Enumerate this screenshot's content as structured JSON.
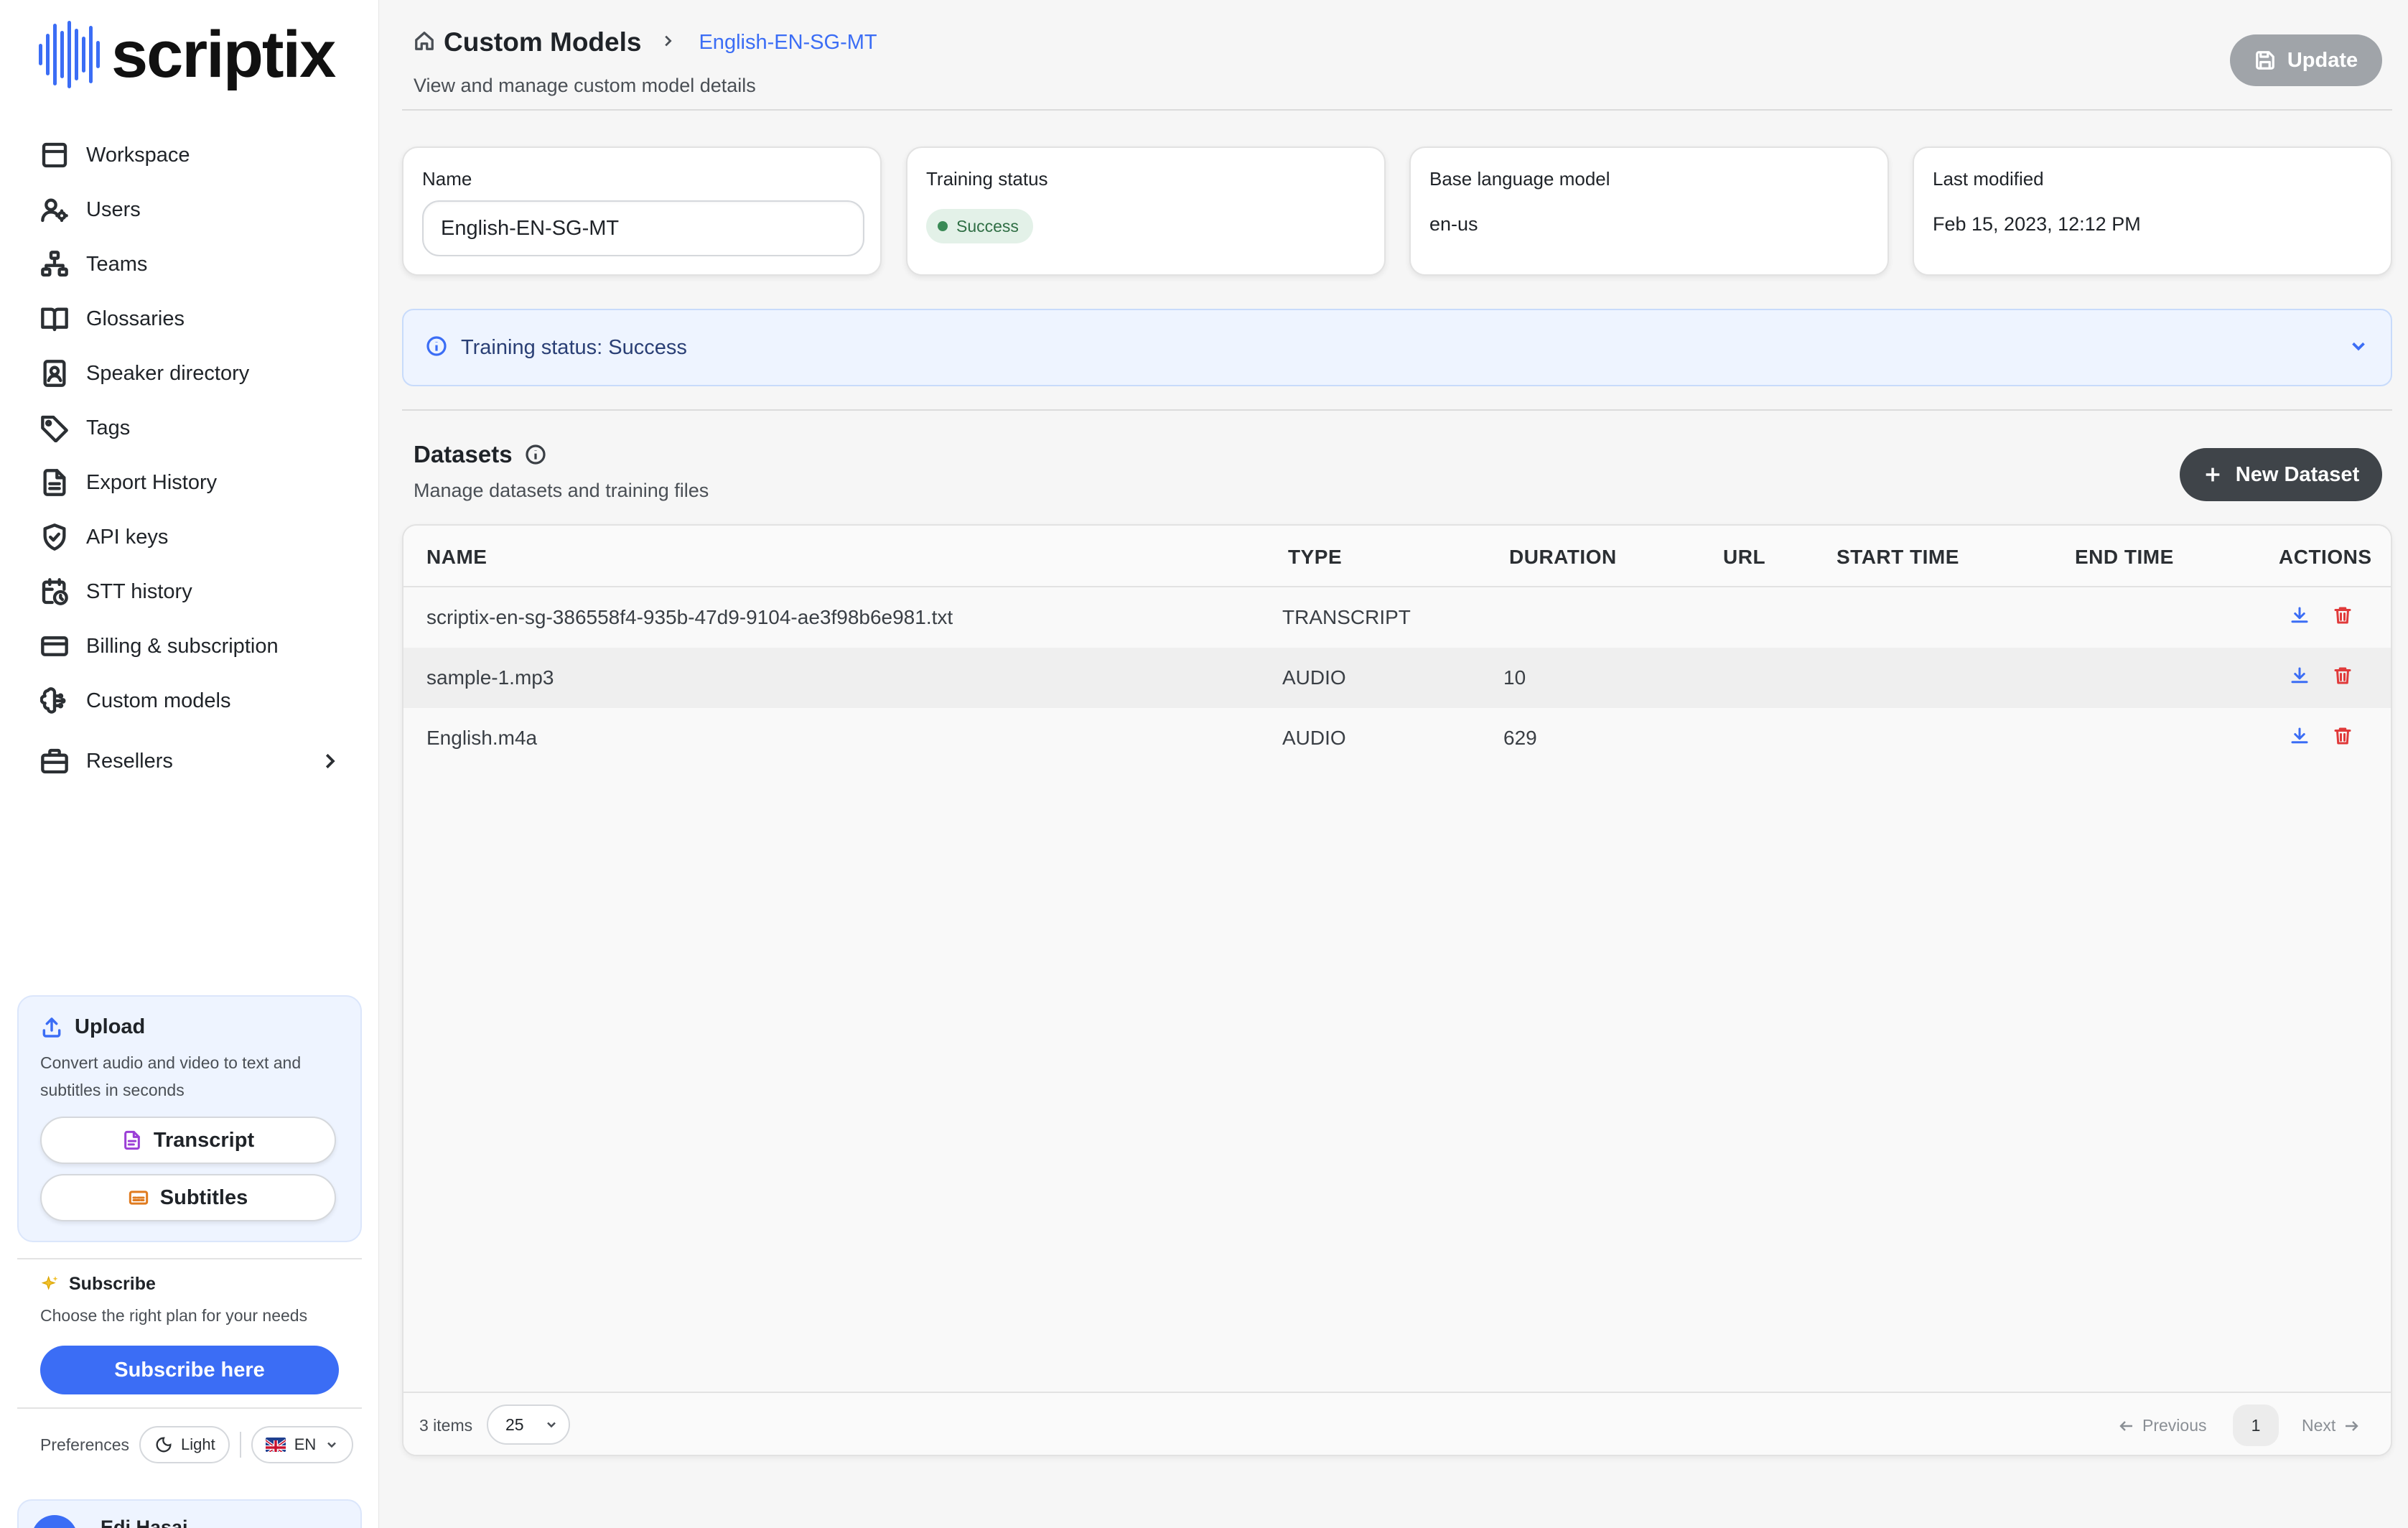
{
  "app": {
    "logo_text": "scriptix"
  },
  "sidebar": {
    "items": [
      {
        "label": "Workspace",
        "icon": "layout-icon"
      },
      {
        "label": "Users",
        "icon": "users-gear-icon"
      },
      {
        "label": "Teams",
        "icon": "org-chart-icon"
      },
      {
        "label": "Glossaries",
        "icon": "book-icon"
      },
      {
        "label": "Speaker directory",
        "icon": "contact-book-icon"
      },
      {
        "label": "Tags",
        "icon": "tag-icon"
      },
      {
        "label": "Export History",
        "icon": "document-icon"
      },
      {
        "label": "API keys",
        "icon": "shield-check-icon"
      },
      {
        "label": "STT history",
        "icon": "calendar-clock-icon"
      },
      {
        "label": "Billing & subscription",
        "icon": "credit-card-icon"
      },
      {
        "label": "Custom models",
        "icon": "brain-icon"
      },
      {
        "label": "Resellers",
        "icon": "briefcase-icon"
      }
    ],
    "upload": {
      "title": "Upload",
      "description": "Convert audio and video to text and subtitles in seconds",
      "transcript_label": "Transcript",
      "subtitles_label": "Subtitles"
    },
    "subscribe": {
      "title": "Subscribe",
      "description": "Choose the right plan for your needs",
      "button_label": "Subscribe here"
    },
    "preferences": {
      "label": "Preferences",
      "theme": "Light",
      "language": "EN"
    },
    "user": {
      "name": "Edi Hasai"
    }
  },
  "header": {
    "title": "Custom Models",
    "breadcrumb_current": "English-EN-SG-MT",
    "subtitle": "View and manage custom model details",
    "update_label": "Update"
  },
  "cards": {
    "name": {
      "label": "Name",
      "value": "English-EN-SG-MT"
    },
    "training_status": {
      "label": "Training status",
      "value": "Success"
    },
    "base_language_model": {
      "label": "Base language model",
      "value": "en-us"
    },
    "last_modified": {
      "label": "Last modified",
      "value": "Feb 15, 2023, 12:12 PM"
    }
  },
  "status_banner": {
    "text": "Training status: Success"
  },
  "datasets": {
    "title": "Datasets",
    "subtitle": "Manage datasets and training files",
    "new_button_label": "New Dataset",
    "columns": [
      "NAME",
      "TYPE",
      "DURATION",
      "URL",
      "START TIME",
      "END TIME",
      "ACTIONS"
    ],
    "rows": [
      {
        "name": "scriptix-en-sg-386558f4-935b-47d9-9104-ae3f98b6e981.txt",
        "type": "TRANSCRIPT",
        "duration": "",
        "url": "",
        "start_time": "",
        "end_time": ""
      },
      {
        "name": "sample-1.mp3",
        "type": "AUDIO",
        "duration": "10",
        "url": "",
        "start_time": "",
        "end_time": ""
      },
      {
        "name": "English.m4a",
        "type": "AUDIO",
        "duration": "629",
        "url": "",
        "start_time": "",
        "end_time": ""
      }
    ],
    "footer": {
      "items_count": "3 items",
      "page_size": "25",
      "previous_label": "Previous",
      "next_label": "Next",
      "current_page": "1"
    }
  },
  "colors": {
    "accent": "#3b6df5",
    "success_bg": "#e3f1e8",
    "success_text": "#2f6e44",
    "danger": "#e03a3a",
    "dark_button": "#3f4449",
    "disabled_button": "#a0a4a9"
  }
}
